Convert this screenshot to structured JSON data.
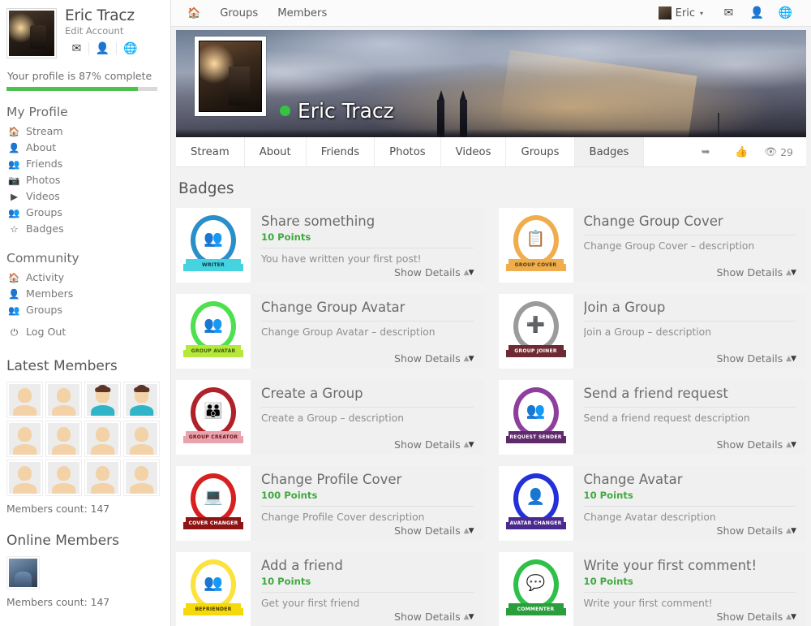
{
  "sidebar": {
    "profile": {
      "name": "Eric Tracz",
      "edit_link": "Edit Account",
      "icons": [
        "envelope-icon",
        "user-icon",
        "globe-icon"
      ]
    },
    "progress": {
      "text": "Your profile is 87% complete",
      "percent": 87,
      "fill_color": "#4cc14c"
    },
    "my_profile": {
      "title": "My Profile",
      "items": [
        {
          "label": "Stream",
          "icon": "home-icon"
        },
        {
          "label": "About",
          "icon": "user-icon"
        },
        {
          "label": "Friends",
          "icon": "users-icon"
        },
        {
          "label": "Photos",
          "icon": "camera-icon"
        },
        {
          "label": "Videos",
          "icon": "video-icon"
        },
        {
          "label": "Groups",
          "icon": "group-icon"
        },
        {
          "label": "Badges",
          "icon": "star-icon"
        }
      ]
    },
    "community": {
      "title": "Community",
      "items": [
        {
          "label": "Activity",
          "icon": "home-icon"
        },
        {
          "label": "Members",
          "icon": "user-icon"
        },
        {
          "label": "Groups",
          "icon": "group-icon"
        }
      ]
    },
    "logout": {
      "label": "Log Out",
      "icon": "power-icon"
    },
    "latest_members": {
      "title": "Latest Members",
      "count_text": "Members count: 147",
      "avatars": [
        "placeholder",
        "placeholder",
        "male",
        "male",
        "placeholder",
        "placeholder",
        "placeholder",
        "placeholder",
        "placeholder",
        "placeholder",
        "placeholder",
        "placeholder"
      ]
    },
    "online_members": {
      "title": "Online Members",
      "count_text": "Members count: 147",
      "avatars": [
        "photo"
      ]
    }
  },
  "topbar": {
    "home_icon": "home-icon",
    "links": [
      "Groups",
      "Members"
    ],
    "user": {
      "name": "Eric",
      "caret": "▾"
    },
    "icons": [
      "envelope-icon",
      "user-icon",
      "globe-icon"
    ]
  },
  "cover": {
    "display_name": "Eric Tracz",
    "online_status": "online",
    "online_color": "#35c442"
  },
  "tabs": {
    "items": [
      "Stream",
      "About",
      "Friends",
      "Photos",
      "Videos",
      "Groups",
      "Badges"
    ],
    "active": "Badges",
    "actions": {
      "share_icon": "share-icon",
      "like_icon": "thumbs-up-icon",
      "views_icon": "eye-icon",
      "views_count": "29"
    }
  },
  "main": {
    "section_title": "Badges",
    "show_details_label": "Show Details",
    "badges": [
      {
        "name": "Share something",
        "points": "10 Points",
        "description": "You have written your first post!",
        "ribbon": "WRITER",
        "ring_color": "#2a8fc9",
        "ribbon_color": "#45d3e0",
        "ribbon_text_color": "#0b3a44",
        "glyph": "👥"
      },
      {
        "name": "Change Group Cover",
        "points": "",
        "description": "Change Group Cover – description",
        "ribbon": "GROUP COVER",
        "ring_color": "#f0ad4e",
        "ribbon_color": "#f0ad4e",
        "ribbon_text_color": "#55400a",
        "glyph": "📋"
      },
      {
        "name": "Change Group Avatar",
        "points": "",
        "description": "Change Group Avatar – description",
        "ribbon": "GROUP AVATAR",
        "ring_color": "#4ee04e",
        "ribbon_color": "#b6e83a",
        "ribbon_text_color": "#3c5a08",
        "glyph": "👥"
      },
      {
        "name": "Join a Group",
        "points": "",
        "description": "Join a Group – description",
        "ribbon": "GROUP JOINER",
        "ring_color": "#9b9b9b",
        "ribbon_color": "#6e2b33",
        "ribbon_text_color": "#ffffff",
        "glyph": "➕"
      },
      {
        "name": "Create a Group",
        "points": "",
        "description": "Create a Group – description",
        "ribbon": "GROUP CREATOR",
        "ring_color": "#b0222a",
        "ribbon_color": "#e8a3ad",
        "ribbon_text_color": "#6e1016",
        "glyph": "👪"
      },
      {
        "name": "Send a friend request",
        "points": "",
        "description": "Send a friend request description",
        "ribbon": "REQUEST SENDER",
        "ring_color": "#8e3f9e",
        "ribbon_color": "#5e2a6b",
        "ribbon_text_color": "#ffffff",
        "glyph": "👥"
      },
      {
        "name": "Change Profile Cover",
        "points": "100 Points",
        "description": "Change Profile Cover description",
        "ribbon": "COVER CHANGER",
        "ring_color": "#d82020",
        "ribbon_color": "#8f1414",
        "ribbon_text_color": "#ffffff",
        "glyph": "💻"
      },
      {
        "name": "Change Avatar",
        "points": "10 Points",
        "description": "Change Avatar description",
        "ribbon": "AVATAR CHANGER",
        "ring_color": "#2430d8",
        "ribbon_color": "#4a2a8f",
        "ribbon_text_color": "#ffffff",
        "glyph": "👤"
      },
      {
        "name": "Add a friend",
        "points": "10 Points",
        "description": "Get your first friend",
        "ribbon": "BEFRIENDER",
        "ring_color": "#fbe23c",
        "ribbon_color": "#f5d90a",
        "ribbon_text_color": "#4a3a00",
        "glyph": "👥"
      },
      {
        "name": "Write your first comment!",
        "points": "10 Points",
        "description": "Write your first comment!",
        "ribbon": "COMMENTER",
        "ring_color": "#2fc04a",
        "ribbon_color": "#2a9e3d",
        "ribbon_text_color": "#ffffff",
        "glyph": "💬"
      }
    ]
  }
}
